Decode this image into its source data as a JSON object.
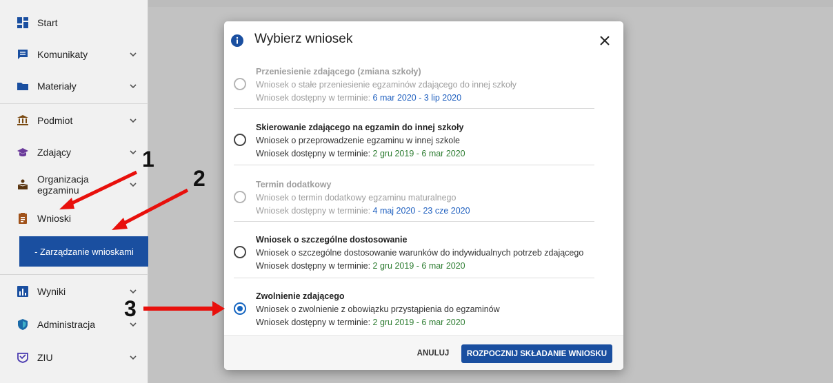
{
  "sidebar": {
    "items": [
      {
        "label": "Start",
        "icon": "dashboard-icon"
      },
      {
        "label": "Komunikaty",
        "icon": "message-icon"
      },
      {
        "label": "Materiały",
        "icon": "folder-icon"
      },
      {
        "label": "Podmiot",
        "icon": "institution-icon"
      },
      {
        "label": "Zdający",
        "icon": "graduation-cap-icon"
      },
      {
        "label_line1": "Organizacja",
        "label_line2": "egzaminu",
        "icon": "organization-icon"
      },
      {
        "label": "Wnioski",
        "icon": "clipboard-icon"
      },
      {
        "label": "Wyniki",
        "icon": "bar-chart-icon"
      },
      {
        "label": "Administracja",
        "icon": "shield-icon"
      },
      {
        "label": "ZIU",
        "icon": "ziu-icon"
      }
    ],
    "sub_item": "- Zarządzanie wnioskami",
    "accent_color": "#1a4fa0"
  },
  "modal": {
    "title": "Wybierz wniosek",
    "term_label": "Wniosek dostępny w terminie: ",
    "options": [
      {
        "title": "Przeniesienie zdającego (zmiana szkoły)",
        "description": "Wniosek o stałe przeniesienie egzaminów zdającego do innej szkoły",
        "term": "6 mar 2020 - 3 lip 2020",
        "state": "disabled"
      },
      {
        "title": "Skierowanie zdającego na egzamin do innej szkoły",
        "description": "Wniosek o przeprowadzenie egzaminu w innej szkole",
        "term": "2 gru 2019 - 6 mar 2020",
        "state": "enabled"
      },
      {
        "title": "Termin dodatkowy",
        "description": "Wniosek o termin dodatkowy egzaminu maturalnego",
        "term": "4 maj 2020 - 23 cze 2020",
        "state": "disabled"
      },
      {
        "title": "Wniosek o szczególne dostosowanie",
        "description": "Wniosek o szczególne dostosowanie warunków do indywidualnych potrzeb zdającego",
        "term": "2 gru 2019 - 6 mar 2020",
        "state": "enabled"
      },
      {
        "title": "Zwolnienie zdającego",
        "description": "Wniosek o zwolnienie z obowiązku przystąpienia do egzaminów",
        "term": "2 gru 2019 - 6 mar 2020",
        "state": "selected"
      }
    ],
    "cancel_label": "ANULUJ",
    "submit_label": "ROZPOCZNIJ SKŁADANIE WNIOSKU"
  },
  "annotations": [
    "1",
    "2",
    "3"
  ],
  "colors": {
    "arrow": "#e8100c",
    "primary": "#1a4fa0",
    "term_green": "#2e7d32",
    "term_blue": "#1e5fbf"
  }
}
